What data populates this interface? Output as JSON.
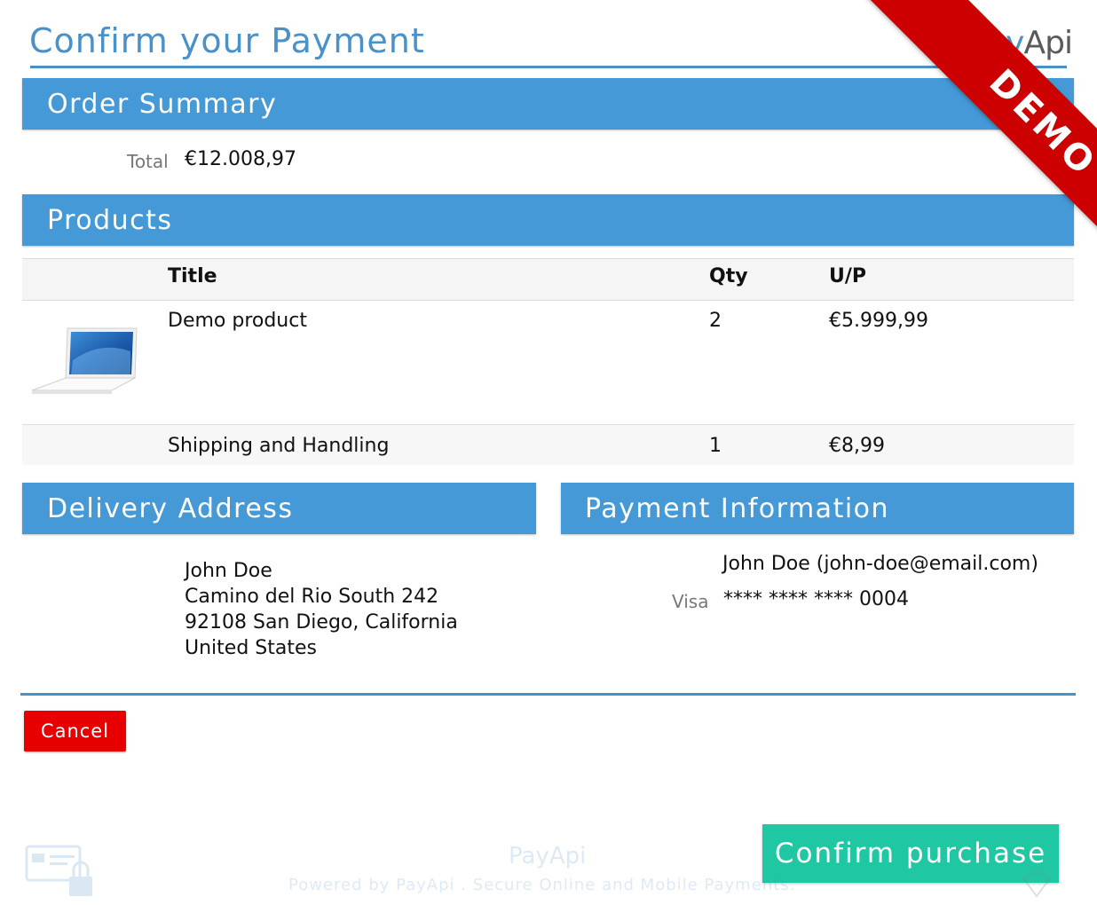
{
  "header": {
    "title": "Confirm your Payment",
    "logo_part1": "Pay",
    "logo_part2": "Api"
  },
  "order_summary": {
    "heading": "Order Summary",
    "total_label": "Total",
    "total_value": "€12.008,97"
  },
  "products": {
    "heading": "Products",
    "columns": [
      "Title",
      "Qty",
      "U/P"
    ],
    "rows": [
      {
        "title": "Demo product",
        "qty": "2",
        "unit_price": "€5.999,99",
        "image": "laptop-image"
      },
      {
        "title": "Shipping and Handling",
        "qty": "1",
        "unit_price": "€8,99"
      }
    ]
  },
  "delivery": {
    "heading": "Delivery Address",
    "lines": [
      "John Doe",
      "Camino del Rio South 242",
      "92108 San Diego, California",
      "United States"
    ]
  },
  "payment": {
    "heading": "Payment Information",
    "name": "John Doe (john-doe@email.com)",
    "card_type": "Visa",
    "card_number": "**** **** **** 0004"
  },
  "actions": {
    "cancel_label": "Cancel",
    "confirm_label": "Confirm purchase"
  },
  "footer": {
    "logo": "PayApi",
    "powered_by": "Powered by",
    "brand": "PayApi",
    "tagline": ". Secure Online and Mobile Payments."
  },
  "ribbon": {
    "label": "DEMO"
  },
  "colors": {
    "accent": "#4499d6",
    "cancel": "#e60000",
    "confirm": "#1fc7a2",
    "ribbon": "#cc0000"
  }
}
